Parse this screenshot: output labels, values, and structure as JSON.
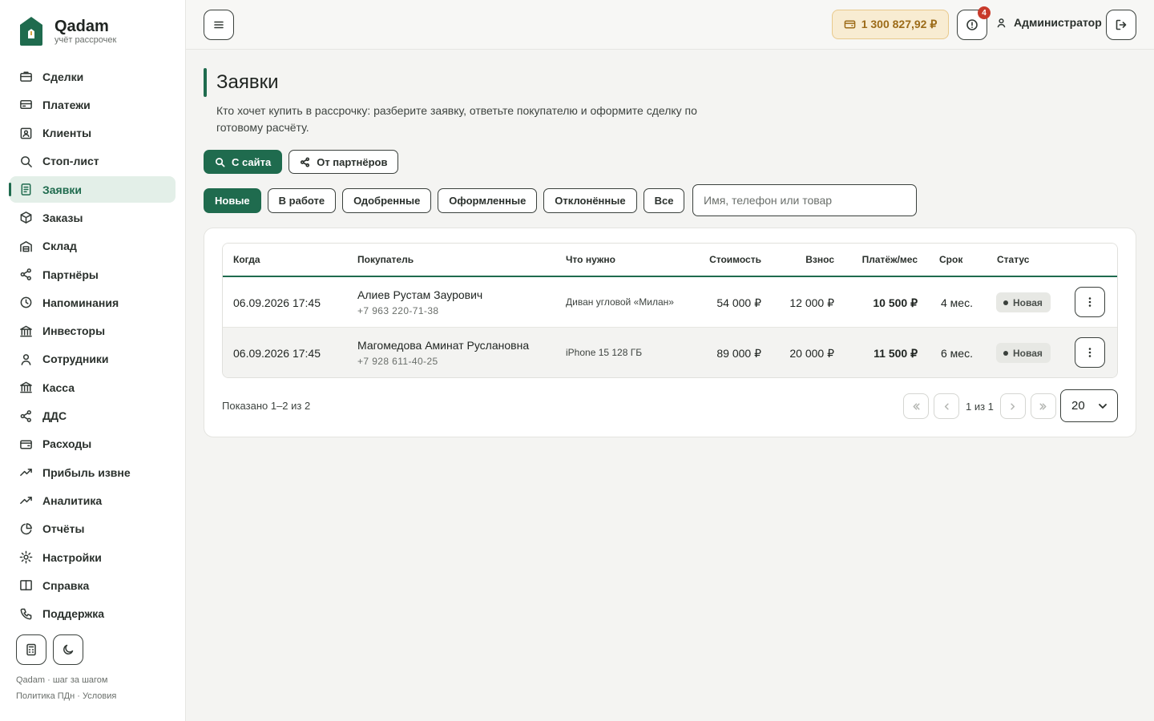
{
  "app": {
    "name": "Qadam",
    "tagline": "учёт рассрочек",
    "brand_color": "#1f6b4e",
    "accent_color": "#9c6b18"
  },
  "sidebar": {
    "items": [
      {
        "label": "Сделки",
        "icon": "briefcase-icon"
      },
      {
        "label": "Платежи",
        "icon": "credit-card-icon"
      },
      {
        "label": "Клиенты",
        "icon": "contact-card-icon"
      },
      {
        "label": "Стоп-лист",
        "icon": "search-icon"
      },
      {
        "label": "Заявки",
        "icon": "document-icon",
        "active": true
      },
      {
        "label": "Заказы",
        "icon": "box-icon"
      },
      {
        "label": "Склад",
        "icon": "warehouse-icon"
      },
      {
        "label": "Партнёры",
        "icon": "share-icon"
      },
      {
        "label": "Напоминания",
        "icon": "clock-icon"
      },
      {
        "label": "Инвесторы",
        "icon": "bank-icon"
      },
      {
        "label": "Сотрудники",
        "icon": "user-icon"
      },
      {
        "label": "Касса",
        "icon": "bank-icon"
      },
      {
        "label": "ДДС",
        "icon": "share-icon"
      },
      {
        "label": "Расходы",
        "icon": "wallet-icon"
      },
      {
        "label": "Прибыль извне",
        "icon": "trend-up-icon"
      },
      {
        "label": "Аналитика",
        "icon": "trend-up-icon"
      },
      {
        "label": "Отчёты",
        "icon": "pie-chart-icon"
      },
      {
        "label": "Настройки",
        "icon": "gear-icon"
      },
      {
        "label": "Справка",
        "icon": "book-icon"
      },
      {
        "label": "Поддержка",
        "icon": "phone-icon"
      }
    ],
    "tools": [
      "calculator-icon",
      "moon-icon"
    ],
    "footer_line1": "Qadam · шаг за шагом",
    "footer_line2": "Политика ПДн · Условия"
  },
  "topbar": {
    "balance": "1 300 827,92 ₽",
    "alerts_count": "4",
    "user_name": "Администратор"
  },
  "page": {
    "title": "Заявки",
    "description": "Кто хочет купить в рассрочку: разберите заявку, ответьте покупателю и оформите сделку по готовому расчёту."
  },
  "source_tabs": [
    {
      "label": "С сайта",
      "icon": "search-icon",
      "active": true
    },
    {
      "label": "От партнёров",
      "icon": "share-icon",
      "active": false
    }
  ],
  "status_filters": [
    {
      "label": "Новые",
      "active": true
    },
    {
      "label": "В работе",
      "active": false
    },
    {
      "label": "Одобренные",
      "active": false
    },
    {
      "label": "Оформленные",
      "active": false
    },
    {
      "label": "Отклонённые",
      "active": false
    },
    {
      "label": "Все",
      "active": false
    }
  ],
  "search": {
    "placeholder": "Имя, телефон или товар",
    "value": ""
  },
  "table": {
    "columns": {
      "when": "Когда",
      "buyer": "Покупатель",
      "need": "Что нужно",
      "cost": "Стоимость",
      "deposit": "Взнос",
      "monthly": "Платёж/мес",
      "term": "Срок",
      "status": "Статус"
    },
    "rows": [
      {
        "when": "06.09.2026 17:45",
        "buyer_name": "Алиев Рустам Заурович",
        "buyer_phone": "+7 963 220-71-38",
        "need": "Диван угловой «Милан»",
        "cost": "54 000 ₽",
        "deposit": "12 000 ₽",
        "monthly": "10 500 ₽",
        "term": "4 мес.",
        "status": "Новая"
      },
      {
        "when": "06.09.2026 17:45",
        "buyer_name": "Магомедова Аминат Руслановна",
        "buyer_phone": "+7 928 611-40-25",
        "need": "iPhone 15 128 ГБ",
        "cost": "89 000 ₽",
        "deposit": "20 000 ₽",
        "monthly": "11 500 ₽",
        "term": "6 мес.",
        "status": "Новая"
      }
    ]
  },
  "pagination": {
    "shown_text": "Показано 1–2 из 2",
    "page_info": "1 из 1",
    "per_page": "20"
  }
}
